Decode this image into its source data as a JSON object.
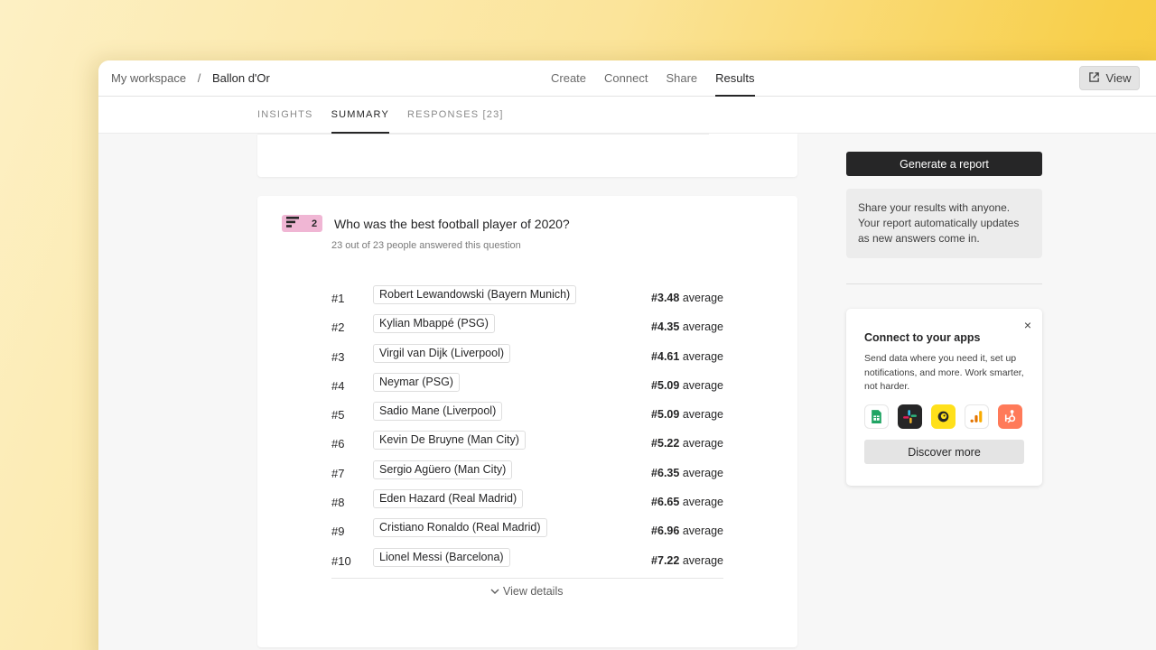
{
  "breadcrumb": {
    "workspace": "My workspace",
    "separator": "/",
    "form": "Ballon d'Or"
  },
  "nav": {
    "items": [
      "Create",
      "Connect",
      "Share",
      "Results"
    ],
    "active": "Results"
  },
  "view_button": {
    "label": "View",
    "icon": "external-link-icon"
  },
  "subtabs": {
    "items": [
      "INSIGHTS",
      "SUMMARY",
      "RESPONSES [23]"
    ],
    "active": "SUMMARY"
  },
  "question": {
    "number": "2",
    "badge_color": "#f0b6d4",
    "icon": "ranking-icon",
    "title": "Who was the best football player of 2020?",
    "answered": "23 out of 23 people answered this question",
    "avg_suffix": "average",
    "rows": [
      {
        "rank": "#1",
        "name": "Robert Lewandowski (Bayern Munich)",
        "avg": "#3.48"
      },
      {
        "rank": "#2",
        "name": "Kylian Mbappé (PSG)",
        "avg": "#4.35"
      },
      {
        "rank": "#3",
        "name": "Virgil van Dijk (Liverpool)",
        "avg": "#4.61"
      },
      {
        "rank": "#4",
        "name": "Neymar (PSG)",
        "avg": "#5.09"
      },
      {
        "rank": "#5",
        "name": "Sadio Mane (Liverpool)",
        "avg": "#5.09"
      },
      {
        "rank": "#6",
        "name": "Kevin De Bruyne (Man City)",
        "avg": "#5.22"
      },
      {
        "rank": "#7",
        "name": "Sergio Agüero (Man City)",
        "avg": "#6.35"
      },
      {
        "rank": "#8",
        "name": "Eden Hazard (Real Madrid)",
        "avg": "#6.65"
      },
      {
        "rank": "#9",
        "name": "Cristiano Ronaldo (Real Madrid)",
        "avg": "#6.96"
      },
      {
        "rank": "#10",
        "name": "Lionel Messi (Barcelona)",
        "avg": "#7.22"
      }
    ],
    "view_details": "View details"
  },
  "sidebar": {
    "generate_report": "Generate a report",
    "share_text": "Share your results with anyone. Your report automatically updates as new answers come in.",
    "apps": {
      "title": "Connect to your apps",
      "description": "Send data where you need it, set up notifications, and more. Work smarter, not harder.",
      "close": "×",
      "icons": [
        "google-sheets-icon",
        "slack-icon",
        "mailchimp-icon",
        "google-analytics-icon",
        "hubspot-icon"
      ],
      "discover": "Discover more"
    }
  },
  "colors": {
    "primary_dark": "#262627",
    "badge_pink": "#f0b6d4"
  }
}
